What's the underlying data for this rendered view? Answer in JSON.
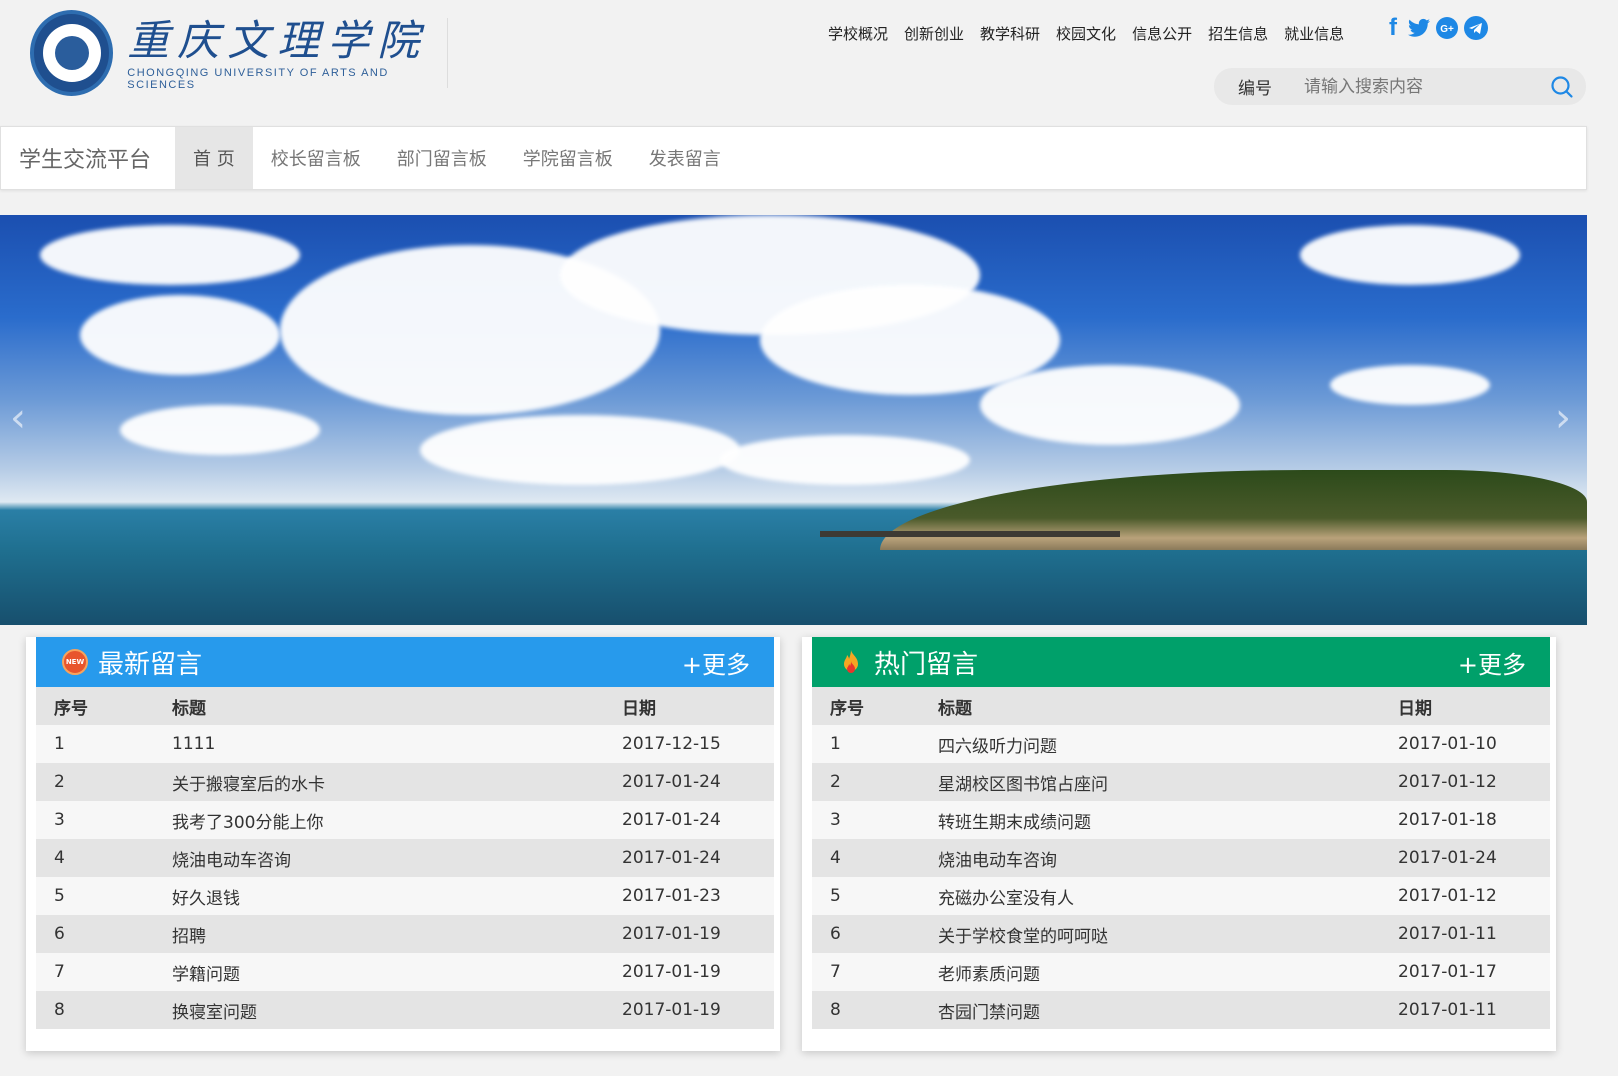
{
  "header": {
    "logo": {
      "cn_name": "重庆文理学院",
      "en_name": "CHONGQING UNIVERSITY OF ARTS AND SCIENCES"
    },
    "top_nav": [
      "学校概况",
      "创新创业",
      "教学科研",
      "校园文化",
      "信息公开",
      "招生信息",
      "就业信息"
    ],
    "social": [
      "facebook-icon",
      "twitter-icon",
      "google-plus-icon",
      "telegram-icon"
    ],
    "search": {
      "type_label": "编号",
      "placeholder": "请输入搜索内容"
    }
  },
  "navbar": {
    "brand": "学生交流平台",
    "items": [
      {
        "label": "首 页",
        "active": true
      },
      {
        "label": "校长留言板",
        "active": false
      },
      {
        "label": "部门留言板",
        "active": false
      },
      {
        "label": "学院留言板",
        "active": false
      },
      {
        "label": "发表留言",
        "active": false
      }
    ]
  },
  "banner": {
    "prev_arrow": "‹",
    "next_arrow": "›"
  },
  "latest": {
    "title": "最新留言",
    "icon_text": "NEW",
    "more": "+更多",
    "color": "#279aec",
    "columns": [
      "序号",
      "标题",
      "日期"
    ],
    "rows": [
      [
        "1",
        "1111",
        "2017-12-15"
      ],
      [
        "2",
        "关于搬寝室后的水卡",
        "2017-01-24"
      ],
      [
        "3",
        "我考了300分能上你",
        "2017-01-24"
      ],
      [
        "4",
        "烧油电动车咨询",
        "2017-01-24"
      ],
      [
        "5",
        "好久退钱",
        "2017-01-23"
      ],
      [
        "6",
        "招聘",
        "2017-01-19"
      ],
      [
        "7",
        "学籍问题",
        "2017-01-19"
      ],
      [
        "8",
        "换寝室问题",
        "2017-01-19"
      ]
    ]
  },
  "hot": {
    "title": "热门留言",
    "more": "+更多",
    "color": "#00a06a",
    "columns": [
      "序号",
      "标题",
      "日期"
    ],
    "rows": [
      [
        "1",
        "四六级听力问题",
        "2017-01-10"
      ],
      [
        "2",
        "星湖校区图书馆占座问",
        "2017-01-12"
      ],
      [
        "3",
        "转班生期末成绩问题",
        "2017-01-18"
      ],
      [
        "4",
        "烧油电动车咨询",
        "2017-01-24"
      ],
      [
        "5",
        "充磁办公室没有人",
        "2017-01-12"
      ],
      [
        "6",
        "关于学校食堂的呵呵哒",
        "2017-01-11"
      ],
      [
        "7",
        "老师素质问题",
        "2017-01-17"
      ],
      [
        "8",
        "杏园门禁问题",
        "2017-01-11"
      ]
    ]
  }
}
